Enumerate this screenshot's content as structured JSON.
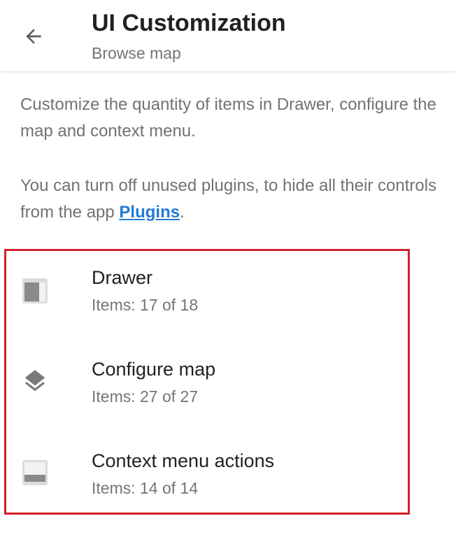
{
  "appbar": {
    "title": "UI Customization",
    "subtitle": "Browse map",
    "back_icon": "arrow-back-icon"
  },
  "description": {
    "line1": "Customize the quantity of items in Drawer, configure the map and context menu.",
    "line2_text": "You can turn off unused plugins, to hide all their controls from the app ",
    "line2_link": "Plugins",
    "line2_end": "."
  },
  "items": [
    {
      "title": "Drawer",
      "subtitle": "Items: 17 of 18",
      "icon": "drawer-icon"
    },
    {
      "title": "Configure map",
      "subtitle": "Items: 27 of 27",
      "icon": "layers-icon"
    },
    {
      "title": "Context menu actions",
      "subtitle": "Items: 14 of 14",
      "icon": "context-menu-icon"
    }
  ],
  "colors": {
    "highlight_border": "#d3202a",
    "link": "#237bd3",
    "icon": "#8a8a8a"
  }
}
